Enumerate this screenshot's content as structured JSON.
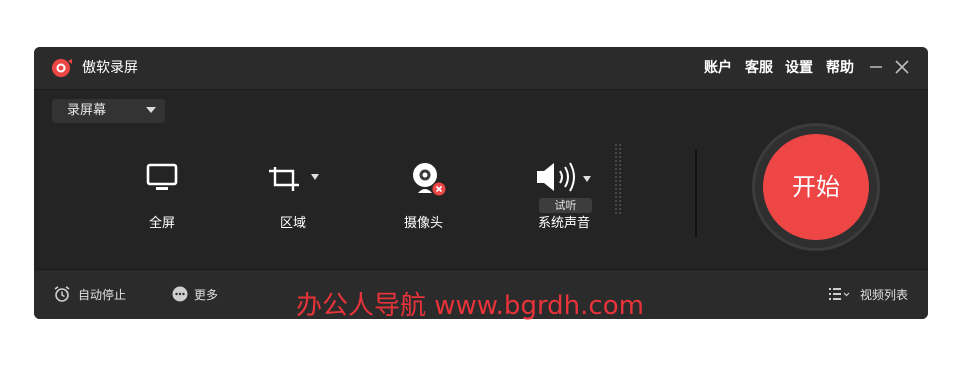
{
  "app": {
    "title": "傲软录屏",
    "accent_color": "#ee4545",
    "logo_icon": "record-logo-icon"
  },
  "header": {
    "menu": [
      "账户",
      "客服",
      "设置",
      "帮助"
    ],
    "minimize_icon": "minimize-icon",
    "close_icon": "close-icon"
  },
  "mode_select": {
    "value": "录屏幕",
    "icon": "chevron-down-icon"
  },
  "tools": [
    {
      "label": "全屏",
      "icon": "monitor-icon"
    },
    {
      "label": "区域",
      "icon": "crop-icon"
    },
    {
      "label": "摄像头",
      "icon": "webcam-icon"
    },
    {
      "label": "系统声音",
      "icon": "speaker-icon",
      "badge": "试听"
    }
  ],
  "start_button": {
    "label": "开始"
  },
  "footer": {
    "auto_stop": "自动停止",
    "more": "更多",
    "video_list": "视频列表"
  },
  "watermark": "办公人导航 www.bgrdh.com"
}
